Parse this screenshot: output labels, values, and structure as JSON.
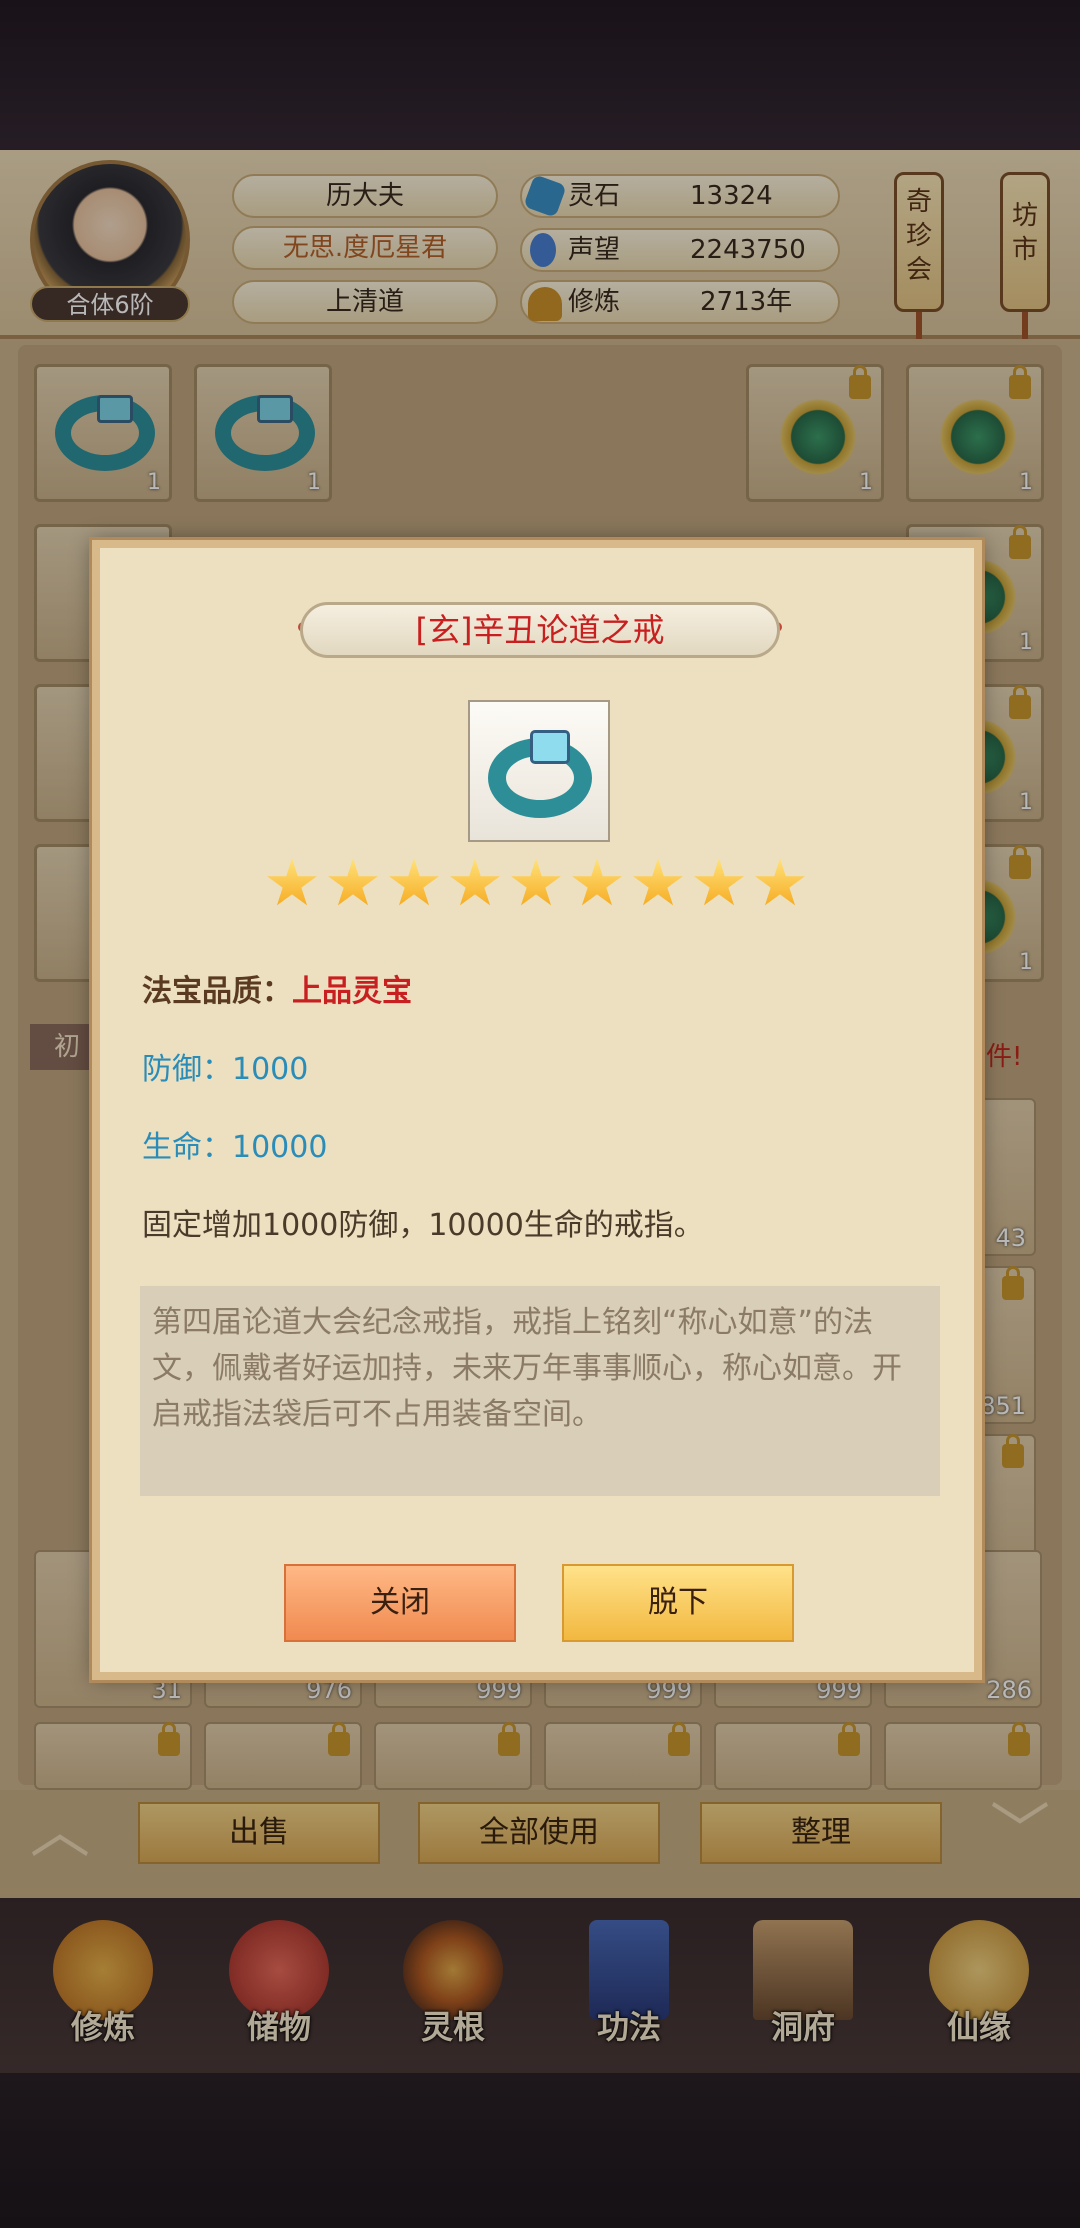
{
  "player": {
    "name": "历大夫",
    "title": "无思.度厄星君",
    "sect": "上清道",
    "realm": "合体6阶"
  },
  "resources": [
    {
      "label": "灵石",
      "value": "13324",
      "icon": "spirit-stone-icon",
      "color": "#3a8fc7"
    },
    {
      "label": "声望",
      "value": "2243750",
      "icon": "fame-icon",
      "color": "#4a7fd0"
    },
    {
      "label": "修炼",
      "value": "2713年",
      "icon": "meditation-icon",
      "color": "#c9902a"
    }
  ],
  "side_signs": [
    {
      "label": "奇珍会"
    },
    {
      "label": "坊市"
    }
  ],
  "equipment_counts": [
    "1",
    "1",
    "1",
    "1",
    "1",
    "1",
    "1",
    "1",
    "1",
    "1"
  ],
  "banner": {
    "left": "初",
    "right": "多件!"
  },
  "inventory_counts": [
    "43",
    "851",
    "999",
    "31",
    "976",
    "999",
    "999",
    "999",
    "286"
  ],
  "actions": {
    "sell": "出售",
    "use_all": "全部使用",
    "sort": "整理"
  },
  "nav": [
    {
      "label": "修炼",
      "icon": "cultivate-icon"
    },
    {
      "label": "储物",
      "icon": "storage-bag-icon"
    },
    {
      "label": "灵根",
      "icon": "spirit-root-icon"
    },
    {
      "label": "功法",
      "icon": "technique-book-icon"
    },
    {
      "label": "洞府",
      "icon": "cave-house-icon"
    },
    {
      "label": "仙缘",
      "icon": "immortal-fate-icon"
    }
  ],
  "dialog": {
    "title": "[玄]辛丑论道之戒",
    "star_count": 9,
    "quality_label": "法宝品质：",
    "quality_value": "上品灵宝",
    "defense_label": "防御：",
    "defense_value": "1000",
    "life_label": "生命：",
    "life_value": "10000",
    "effect": "固定增加1000防御，10000生命的戒指。",
    "description": "第四届论道大会纪念戒指，戒指上铭刻“称心如意”的法文，佩戴者好运加持，未来万年事事顺心，称心如意。开启戒指法袋后可不占用装备空间。",
    "close_label": "关闭",
    "unequip_label": "脱下"
  },
  "colors": {
    "quality": "#c82020",
    "stat": "#2a8cb8",
    "title": "#c82020"
  }
}
